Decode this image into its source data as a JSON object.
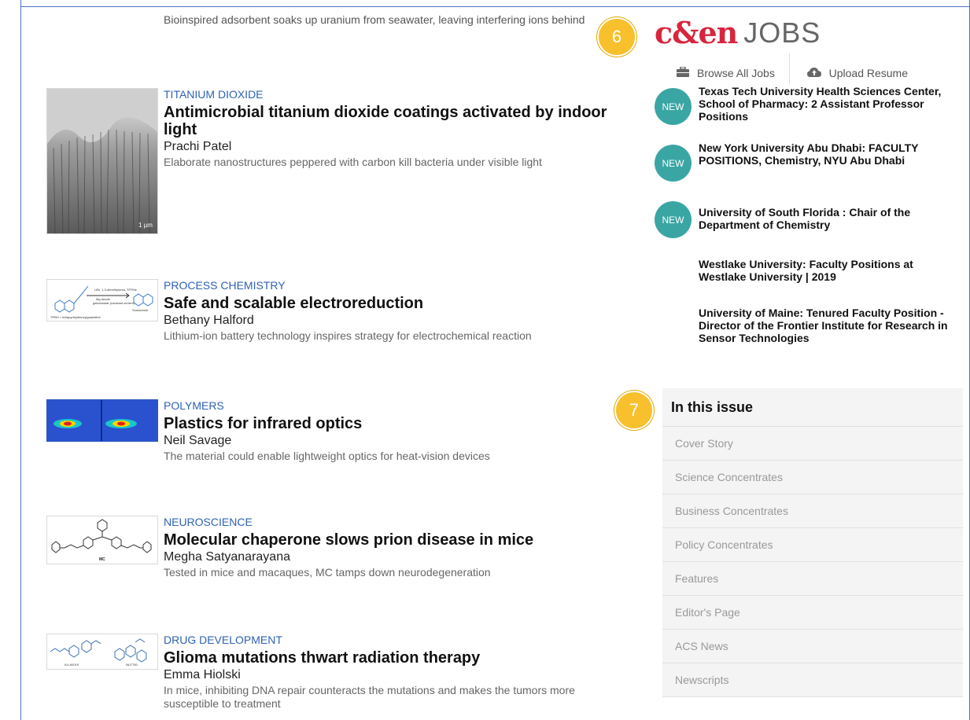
{
  "top_snippet": "Bioinspired adsorbent soaks up uranium from seawater, leaving interfering ions behind",
  "articles": [
    {
      "category": "TITANIUM DIOXIDE",
      "title": "Antimicrobial titanium dioxide coatings activated by indoor light",
      "author": "Prachi Patel",
      "teaser": "Elaborate nanostructures peppered with carbon kill bacteria under visible light",
      "image_label": "1 µm"
    },
    {
      "category": "PROCESS CHEMISTRY",
      "title": "Safe and scalable electroreduction",
      "author": "Bethany Halford",
      "teaser": "Lithium-ion battery technology inspires strategy for electrochemical reaction"
    },
    {
      "category": "POLYMERS",
      "title": "Plastics for infrared optics",
      "author": "Neil Savage",
      "teaser": "The material could enable lightweight optics for heat-vision devices"
    },
    {
      "category": "NEUROSCIENCE",
      "title": "Molecular chaperone slows prion disease in mice",
      "author": "Megha Satyanarayana",
      "teaser": "Tested in mice and macaques, MC tamps down neurodegeneration",
      "image_label": "MC"
    },
    {
      "category": "DRUG DEVELOPMENT",
      "title": "Glioma mutations thwart radiation therapy",
      "author": "Emma Hiolski",
      "teaser": "In mice, inhibiting DNA repair counteracts the mutations and makes the tumors more susceptible to treatment"
    }
  ],
  "jobs": {
    "brand": "c&en",
    "word": "JOBS",
    "browse_label": "Browse All Jobs",
    "upload_label": "Upload Resume",
    "listings": [
      {
        "badge": "NEW",
        "title": "Texas Tech University Health Sciences Center, School of Pharmacy: 2 Assistant Professor Positions"
      },
      {
        "badge": "NEW",
        "title": "New York University Abu Dhabi: FACULTY POSITIONS, Chemistry, NYU Abu Dhabi"
      },
      {
        "badge": "NEW",
        "title": "University of South Florida : Chair of the Department of Chemistry"
      },
      {
        "title": "Westlake University: Faculty Positions at Westlake University | 2019"
      },
      {
        "title": "University of Maine: Tenured Faculty Position - Director of the Frontier Institute for Research in Sensor Technologies"
      }
    ]
  },
  "issue": {
    "heading": "In this issue",
    "items": [
      "Cover Story",
      "Science Concentrates",
      "Business Concentrates",
      "Policy Concentrates",
      "Features",
      "Editor's Page",
      "ACS News",
      "Newscripts"
    ]
  },
  "markers": [
    "6",
    "7"
  ],
  "colors": {
    "category": "#2f62b5",
    "brand": "#d7263d",
    "badge": "#3aa6a4",
    "marker": "#f7c02c"
  }
}
